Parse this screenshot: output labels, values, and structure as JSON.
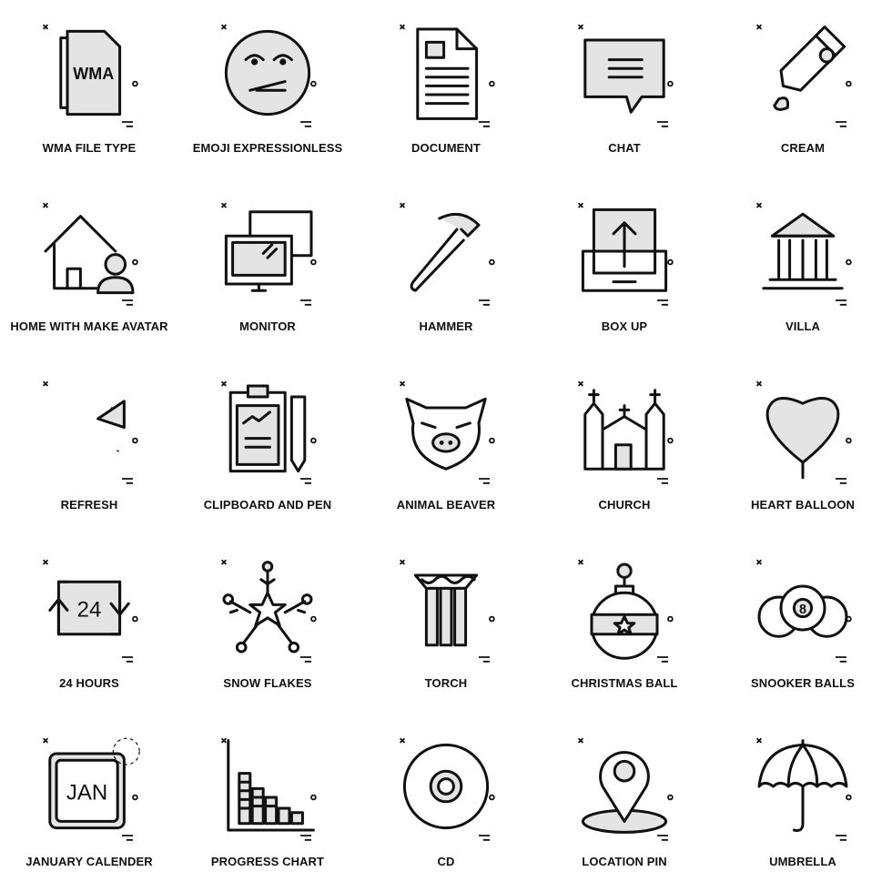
{
  "icons": [
    {
      "label": "WMA FILE TYPE",
      "icon": "wma-file-icon",
      "text": "WMA"
    },
    {
      "label": "EMOJI EXPRESSIONLESS",
      "icon": "emoji-expressionless-icon"
    },
    {
      "label": "DOCUMENT",
      "icon": "document-icon"
    },
    {
      "label": "CHAT",
      "icon": "chat-icon"
    },
    {
      "label": "CREAM",
      "icon": "cream-icon"
    },
    {
      "label": "HOME WITH MAKE AVATAR",
      "icon": "home-avatar-icon"
    },
    {
      "label": "MONITOR",
      "icon": "monitor-icon"
    },
    {
      "label": "HAMMER",
      "icon": "hammer-icon"
    },
    {
      "label": "BOX UP",
      "icon": "box-up-icon"
    },
    {
      "label": "VILLA",
      "icon": "villa-icon"
    },
    {
      "label": "REFRESH",
      "icon": "refresh-icon"
    },
    {
      "label": "CLIPBOARD AND PEN",
      "icon": "clipboard-pen-icon"
    },
    {
      "label": "ANIMAL BEAVER",
      "icon": "animal-beaver-icon"
    },
    {
      "label": "CHURCH",
      "icon": "church-icon"
    },
    {
      "label": "HEART BALLOON",
      "icon": "heart-balloon-icon"
    },
    {
      "label": "24 HOURS",
      "icon": "24-hours-icon",
      "text": "24"
    },
    {
      "label": "SNOW FLAKES",
      "icon": "snow-flakes-icon"
    },
    {
      "label": "TORCH",
      "icon": "torch-icon"
    },
    {
      "label": "CHRISTMAS BALL",
      "icon": "christmas-ball-icon"
    },
    {
      "label": "SNOOKER BALLS",
      "icon": "snooker-balls-icon",
      "text": "8"
    },
    {
      "label": "JANUARY CALENDER",
      "icon": "january-calendar-icon",
      "text": "JAN"
    },
    {
      "label": "PROGRESS CHART",
      "icon": "progress-chart-icon"
    },
    {
      "label": "CD",
      "icon": "cd-icon"
    },
    {
      "label": "LOCATION PIN",
      "icon": "location-pin-icon"
    },
    {
      "label": "UMBRELLA",
      "icon": "umbrella-icon"
    }
  ]
}
